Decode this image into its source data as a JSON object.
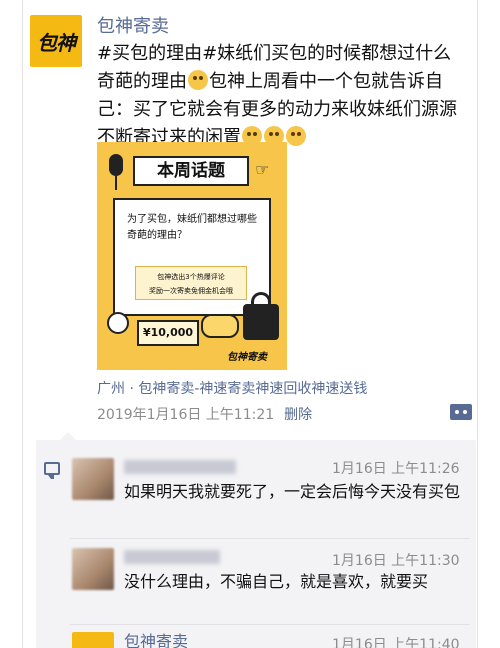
{
  "post": {
    "avatar_text": "包神",
    "nickname": "包神寄卖",
    "text_1": "#买包的理由#妹纸们买包的时候都想过什么奇葩的理由",
    "text_2": "包神上周看中一个包就告诉自己：买了它就会有更多的动力来收妹纸们源源不断寄过来的闲置",
    "image": {
      "title": "本周话题",
      "question": "为了买包，妹纸们都想过哪些奇葩的理由？",
      "note_line1": "包神选出3个热爆评论",
      "note_line2": "奖励一次寄卖免佣金机会哦",
      "money": "¥10,000",
      "brand": "包神寄卖"
    },
    "location": "广州 · 包神寄卖-神速寄卖神速回收神速送钱",
    "timestamp": "2019年1月16日 上午11:21",
    "delete_label": "删除"
  },
  "comments": [
    {
      "time": "1月16日 上午11:26",
      "text": "如果明天我就要死了，一定会后悔今天没有买包"
    },
    {
      "time": "1月16日 上午11:30",
      "text": "没什么理由，不骗自己，就是喜欢，就要买"
    },
    {
      "name": "包神寄卖",
      "time": "1月16日 上午11:40"
    }
  ],
  "colors": {
    "link": "#576b95",
    "brand_yellow": "#f5b914",
    "comment_bg": "#f3f3f5"
  }
}
